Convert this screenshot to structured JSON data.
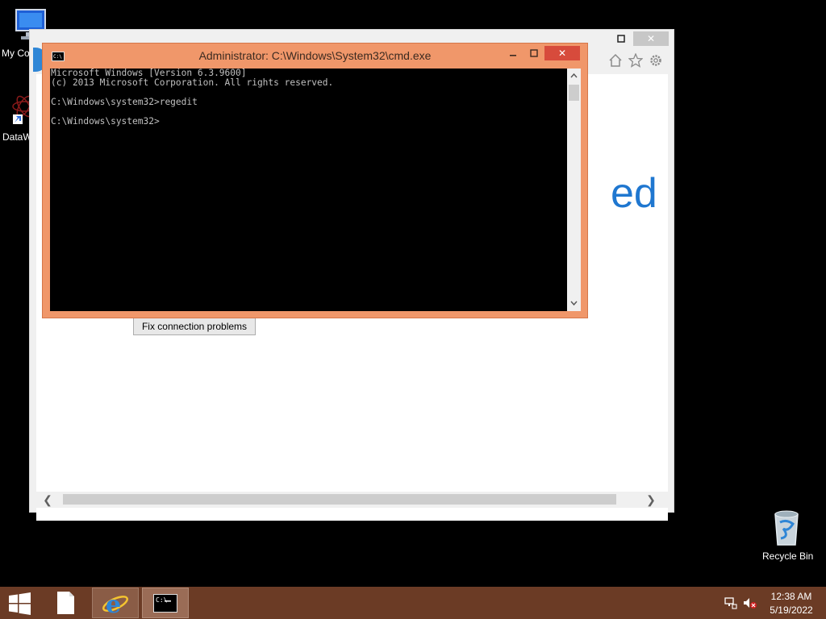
{
  "desktop": {
    "icons": [
      {
        "label": "My Co"
      },
      {
        "label": "DataW"
      },
      {
        "label": "Recycle Bin"
      }
    ]
  },
  "ie": {
    "partial_heading": "ed",
    "fix_button": "Fix connection problems"
  },
  "cmd": {
    "title": "Administrator: C:\\Windows\\System32\\cmd.exe",
    "lines": [
      "Microsoft Windows [Version 6.3.9600]",
      "(c) 2013 Microsoft Corporation. All rights reserved.",
      "",
      "C:\\Windows\\system32>regedit",
      "",
      "C:\\Windows\\system32>"
    ]
  },
  "taskbar": {
    "time": "12:38 AM",
    "date": "5/19/2022"
  },
  "colors": {
    "taskbar": "#6b3b25",
    "cmd_frame": "#f0976a",
    "ie_accent": "#1f77d0"
  }
}
